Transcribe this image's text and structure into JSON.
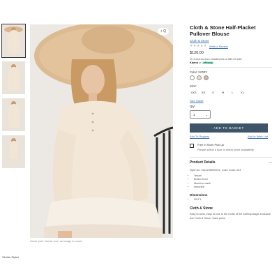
{
  "product": {
    "title": "Cloth & Stone Half-Placket Pullover Blouse",
    "brand": "Cloth & Stone",
    "stars": "★★★★★",
    "review_link": "Write a Review",
    "price": "$120.00",
    "installments": "Or 4 interest-free installments of $30.00 with",
    "pay_klarna": "Klarna",
    "pay_or": "or",
    "pay_afterpay": "afterpay"
  },
  "color": {
    "label": "Color: IVORY",
    "swatches": [
      "#ffffff",
      "#e9ddca",
      "#d9b2a4"
    ]
  },
  "size": {
    "label": "Size*",
    "options": [
      "XXS",
      "XS",
      "S",
      "M",
      "L",
      "XL"
    ]
  },
  "size_guide": "Size Guide",
  "qty": {
    "label": "Qty*",
    "value": "1"
  },
  "actions": {
    "add_to_basket": "ADD TO BASKET",
    "add_to_registry": "Add To Registry",
    "add_to_wishlist": "Add to Wish List"
  },
  "pickup": {
    "title": "Free In Store Pick Up",
    "sub": "Please select a size to check store availability"
  },
  "details": {
    "title": "Product Details",
    "style_no": "Style No. 4110298990091; Color Code: 024",
    "bullets": [
      "Tencel",
      "Button front",
      "Machine wash",
      "Imported"
    ],
    "dimensions_title": "Dimensions",
    "dimensions": [
      "26.5\"L"
    ]
  },
  "cloth_stone": {
    "title": "Cloth & Stone",
    "desc": "Easy to wear, easy to love is the motto of the Anthropologie exclusive line Cloth & Stone. Each piece"
  },
  "image": {
    "zoom_badge": "+ Q",
    "caption": "Hover your mouse over an image to zoom."
  },
  "bottom_text": "Similar Styles"
}
